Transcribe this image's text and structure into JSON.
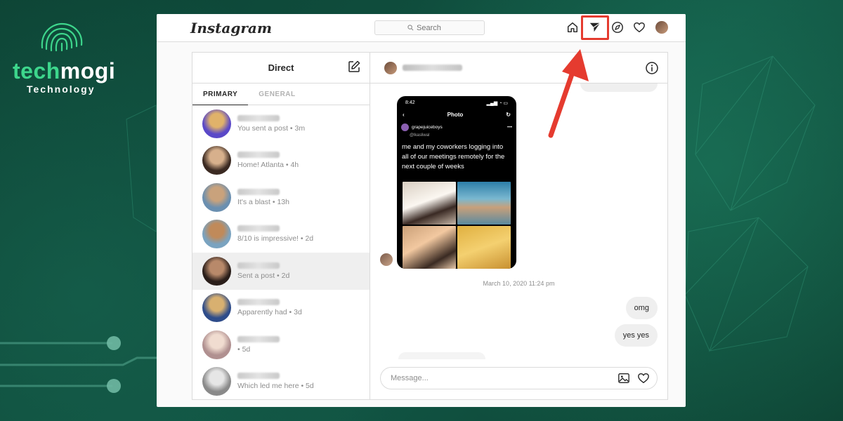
{
  "brand": {
    "word_a": "tech",
    "word_b": "mogi",
    "sub": "Technology"
  },
  "app": {
    "logo": "Instagram",
    "search_placeholder": "Search"
  },
  "nav": [
    {
      "icon": "home-icon"
    },
    {
      "icon": "direct-send-icon",
      "highlighted": true
    },
    {
      "icon": "explore-compass-icon"
    },
    {
      "icon": "heart-icon"
    },
    {
      "icon": "profile-avatar"
    }
  ],
  "inbox": {
    "title": "Direct",
    "tabs": [
      {
        "label": "PRIMARY",
        "active": true
      },
      {
        "label": "GENERAL",
        "active": false
      }
    ],
    "threads": [
      {
        "preview": "You sent a post • 3m",
        "color_a": "#5a48c8",
        "color_b": "#e0b26a"
      },
      {
        "preview": "Home! Atlanta • 4h",
        "color_a": "#3b2a22",
        "color_b": "#d7b08c"
      },
      {
        "preview": "It's a blast • 13h",
        "color_a": "#6a8fb0",
        "color_b": "#c9a27c"
      },
      {
        "preview": "8/10 is impressive! • 2d",
        "color_a": "#7aa3c0",
        "color_b": "#c08a5a"
      },
      {
        "preview": "Sent a post • 2d",
        "color_a": "#2a1e1a",
        "color_b": "#b8896a",
        "selected": true
      },
      {
        "preview": "Apparently had • 3d",
        "color_a": "#2e4c8a",
        "color_b": "#d8b070"
      },
      {
        "preview": "• 5d",
        "color_a": "#b09090",
        "color_b": "#f0dcd0"
      },
      {
        "preview": "Which led me here • 5d",
        "color_a": "#8a8a8a",
        "color_b": "#e6e6e6"
      }
    ]
  },
  "chat": {
    "post": {
      "time": "8:42",
      "screen_title": "Photo",
      "account": "grapejuiceboys",
      "handle": "@lkasliwal",
      "caption": "me and my coworkers logging into all of our meetings remotely for the next couple of weeks"
    },
    "timestamp": "March 10, 2020 11:24 pm",
    "messages": [
      {
        "text": "omg"
      },
      {
        "text": "yes yes"
      }
    ],
    "composer_placeholder": "Message..."
  },
  "colors": {
    "highlight": "#e53b2f",
    "brand_green": "#3dd68c",
    "background": "#0f4a3a"
  }
}
